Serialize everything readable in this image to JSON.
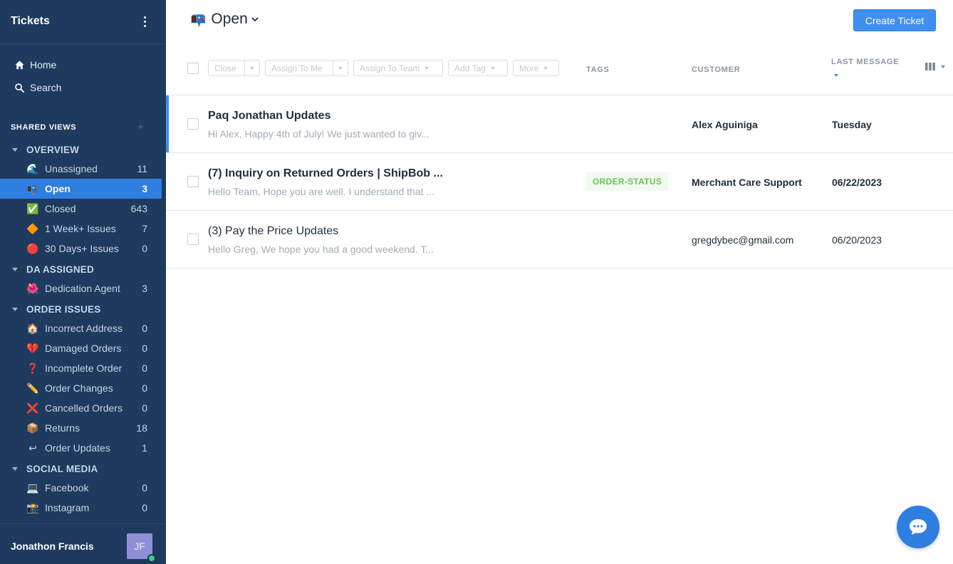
{
  "sidebar": {
    "title": "Tickets",
    "nav": [
      {
        "label": "Home",
        "icon": "home-icon"
      },
      {
        "label": "Search",
        "icon": "search-icon"
      }
    ],
    "section_label": "SHARED VIEWS",
    "section_add": "+",
    "groups": [
      {
        "label": "OVERVIEW",
        "views": [
          {
            "emoji": "🌊",
            "label": "Unassigned",
            "count": "11"
          },
          {
            "emoji": "📭",
            "label": "Open",
            "count": "3"
          },
          {
            "emoji": "✅",
            "label": "Closed",
            "count": "643"
          },
          {
            "emoji": "🔶",
            "label": "1 Week+ Issues",
            "count": "7"
          },
          {
            "emoji": "🔴",
            "label": "30 Days+ Issues",
            "count": "0"
          }
        ]
      },
      {
        "label": "DA ASSIGNED",
        "views": [
          {
            "emoji": "🌺",
            "label": "Dedication Agent",
            "count": "3"
          }
        ]
      },
      {
        "label": "ORDER ISSUES",
        "views": [
          {
            "emoji": "🏠",
            "label": "Incorrect Address",
            "count": "0"
          },
          {
            "emoji": "💔",
            "label": "Damaged Orders",
            "count": "0"
          },
          {
            "emoji": "❓",
            "label": "Incomplete Order",
            "count": "0"
          },
          {
            "emoji": "✏️",
            "label": "Order Changes",
            "count": "0"
          },
          {
            "emoji": "❌",
            "label": "Cancelled Orders",
            "count": "0"
          },
          {
            "emoji": "📦",
            "label": "Returns",
            "count": "18"
          },
          {
            "emoji": "↩",
            "label": "Order Updates",
            "count": "1"
          }
        ]
      },
      {
        "label": "SOCIAL MEDIA",
        "views": [
          {
            "emoji": "💻",
            "label": "Facebook",
            "count": "0"
          },
          {
            "emoji": "📸",
            "label": "Instagram",
            "count": "0"
          }
        ]
      }
    ],
    "user": {
      "name": "Jonathon Francis",
      "initials": "JF"
    }
  },
  "header": {
    "emoji": "📭",
    "title": "Open",
    "create_label": "Create Ticket"
  },
  "toolbar": {
    "close_label": "Close",
    "assign_me_label": "Assign To Me",
    "assign_team_label": "Assign To Team",
    "add_tag_label": "Add Tag",
    "more_label": "More"
  },
  "columns": {
    "tags": "TAGS",
    "customer": "CUSTOMER",
    "last_message": "LAST MESSAGE"
  },
  "tickets": [
    {
      "subject": "Paq Jonathan Updates",
      "preview": "Hi Alex, Happy 4th of July! We just wanted to giv...",
      "tag": "",
      "customer": "Alex Aguiniga",
      "date": "Tuesday",
      "unread": true
    },
    {
      "subject": "(7) Inquiry on Returned Orders | ShipBob ...",
      "preview": "Hello Team, Hope you are well. I understand that ...",
      "tag": "ORDER-STATUS",
      "customer": "Merchant Care Support",
      "date": "06/22/2023",
      "unread": true
    },
    {
      "subject": "(3) Pay the Price Updates",
      "preview": "Hello Greg, We hope you had a good weekend. T...",
      "tag": "",
      "customer": "gregdybec@gmail.com",
      "date": "06/20/2023",
      "unread": false
    }
  ],
  "colors": {
    "sidebar_bg": "#1e3a5f",
    "accent": "#2e7fe0",
    "tag_green": "#6cc05a"
  }
}
